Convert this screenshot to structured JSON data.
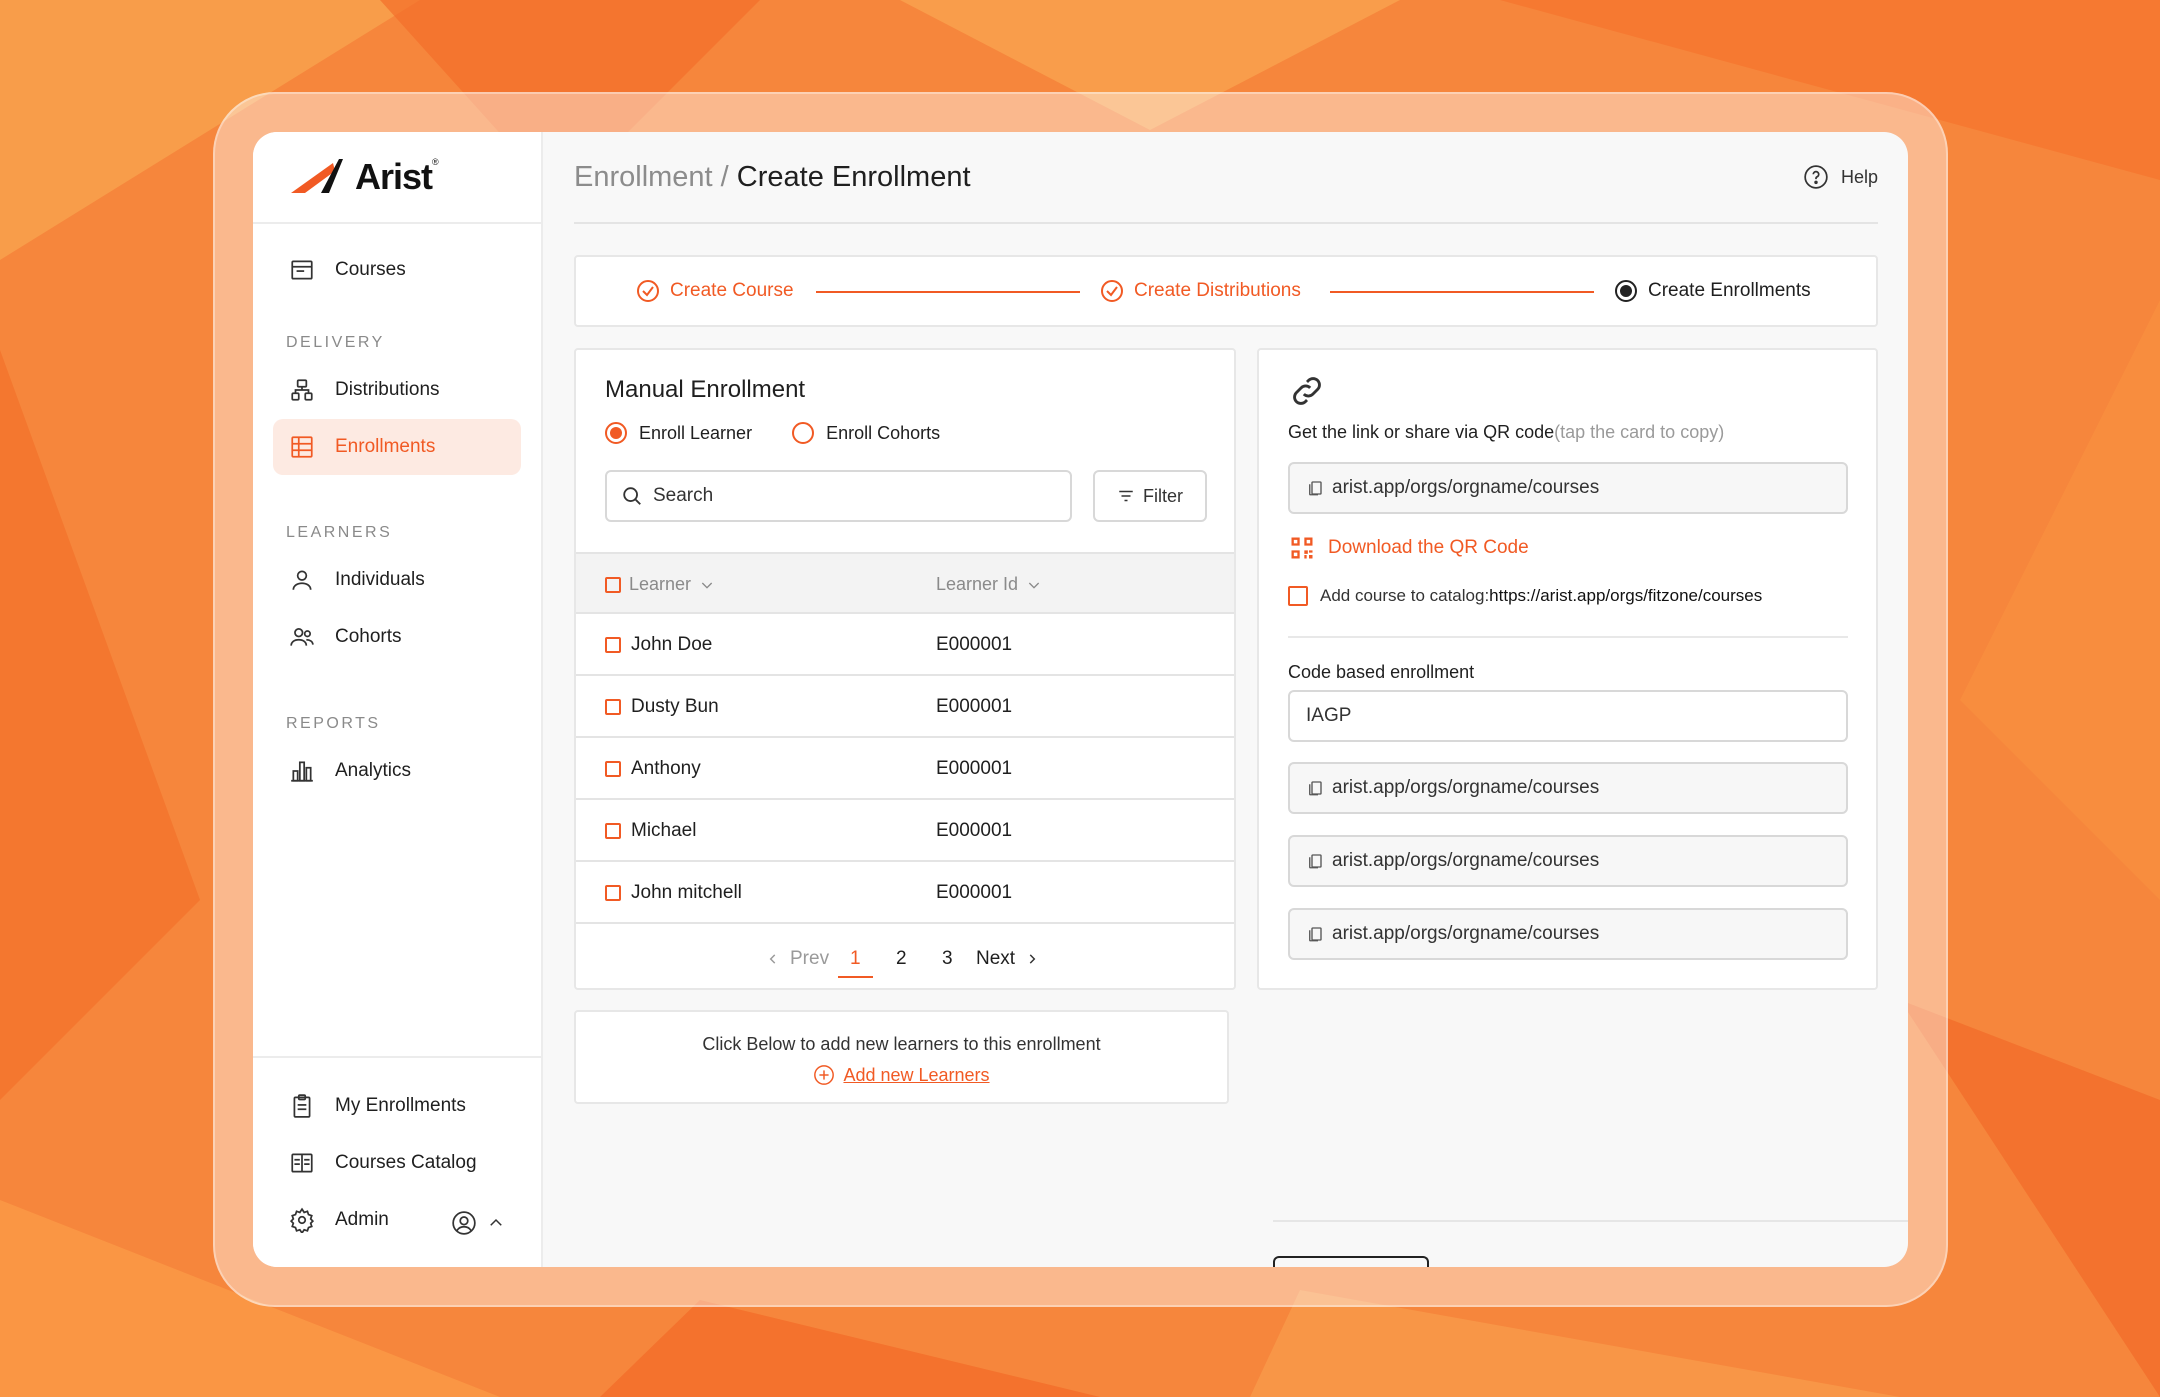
{
  "brand": {
    "name": "Arist",
    "accent": "#f15a24"
  },
  "sidebar": {
    "items": [
      {
        "label": "Courses",
        "icon": "courses-icon"
      },
      {
        "label": "Distributions",
        "icon": "distributions-icon"
      },
      {
        "label": "Enrollments",
        "icon": "enrollments-icon",
        "active": true
      },
      {
        "label": "Individuals",
        "icon": "person-icon"
      },
      {
        "label": "Cohorts",
        "icon": "people-icon"
      },
      {
        "label": "Analytics",
        "icon": "chart-icon"
      }
    ],
    "sections": [
      "DELIVERY",
      "LEARNERS",
      "REPORTS"
    ],
    "footer": [
      {
        "label": "My Enrollments",
        "icon": "clipboard-icon"
      },
      {
        "label": "Courses Catalog",
        "icon": "catalog-icon"
      },
      {
        "label": "Admin",
        "icon": "gear-icon"
      }
    ]
  },
  "header": {
    "breadcrumb_parent": "Enrollment",
    "breadcrumb_sep": " / ",
    "title": "Create Enrollment",
    "help": "Help"
  },
  "stepper": {
    "steps": [
      {
        "label": "Create Course",
        "state": "done"
      },
      {
        "label": "Create Distributions",
        "state": "done"
      },
      {
        "label": "Create Enrollments",
        "state": "current"
      }
    ]
  },
  "manual": {
    "title": "Manual Enrollment",
    "radio_learner": "Enroll Learner",
    "radio_cohorts": "Enroll Cohorts",
    "search_placeholder": "Search",
    "filter": "Filter",
    "columns": [
      "Learner",
      "Learner Id"
    ],
    "rows": [
      {
        "name": "John Doe",
        "id": "E000001"
      },
      {
        "name": "Dusty Bun",
        "id": "E000001"
      },
      {
        "name": "Anthony",
        "id": "E000001"
      },
      {
        "name": "Michael",
        "id": "E000001"
      },
      {
        "name": "John mitchell",
        "id": "E000001"
      }
    ],
    "pager": {
      "prev": "Prev",
      "pages": [
        "1",
        "2",
        "3"
      ],
      "next": "Next"
    }
  },
  "add_learners": {
    "hint": "Click Below to add new learners to this enrollment",
    "link": "Add new Learners"
  },
  "share": {
    "label": "Get the link or share via QR code",
    "label_hint": "(tap the card to copy)",
    "link": "arist.app/orgs/orgname/courses",
    "qr": "Download the QR Code",
    "catalog_prefix": "Add course to catalog:",
    "catalog_url": "https://arist.app/orgs/fitzone/courses",
    "code_label": "Code based enrollment",
    "code_value": "IAGP",
    "code_links": [
      "arist.app/orgs/orgname/courses",
      "arist.app/orgs/orgname/courses",
      "arist.app/orgs/orgname/courses"
    ]
  }
}
